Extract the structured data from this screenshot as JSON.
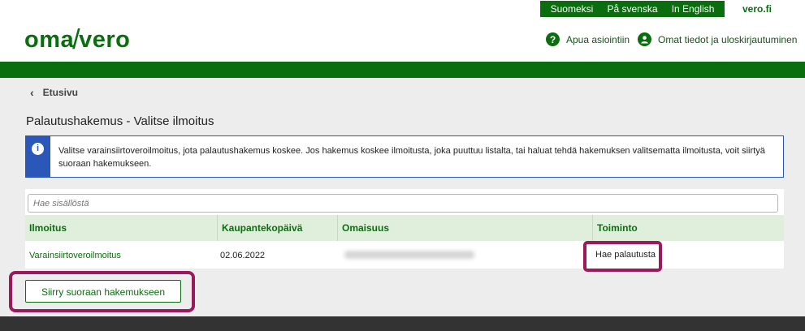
{
  "header": {
    "languages": [
      "Suomeksi",
      "På svenska",
      "In English"
    ],
    "site_link": "vero.fi",
    "logo_left": "oma",
    "logo_slash": "/",
    "logo_right": "vero",
    "help_label": "Apua asiointiin",
    "user_label": "Omat tiedot ja uloskirjautuminen"
  },
  "breadcrumb": {
    "label": "Etusivu"
  },
  "page": {
    "title": "Palautushakemus - Valitse ilmoitus"
  },
  "info": {
    "text": "Valitse varainsiirtoveroilmoitus, jota palautushakemus koskee. Jos hakemus koskee ilmoitusta, joka puuttuu listalta, tai haluat tehdä hakemuksen valitsematta ilmoitusta, voit siirtyä suoraan hakemukseen."
  },
  "search": {
    "placeholder": "Hae sisällöstä"
  },
  "table": {
    "headers": [
      "Ilmoitus",
      "Kaupantekopäivä",
      "Omaisuus",
      "Toiminto"
    ],
    "rows": [
      {
        "ilmoitus": "Varainsiirtoveroilmoitus",
        "date": "02.06.2022",
        "action": "Hae palautusta"
      }
    ]
  },
  "buttons": {
    "direct": "Siirry suoraan hakemukseen"
  },
  "colors": {
    "brand_green": "#0a6e0f",
    "info_blue": "#2b58b8",
    "highlight": "#9a1a5b"
  },
  "icons": [
    "chevron-left-icon",
    "help-icon",
    "user-icon",
    "info-icon"
  ]
}
